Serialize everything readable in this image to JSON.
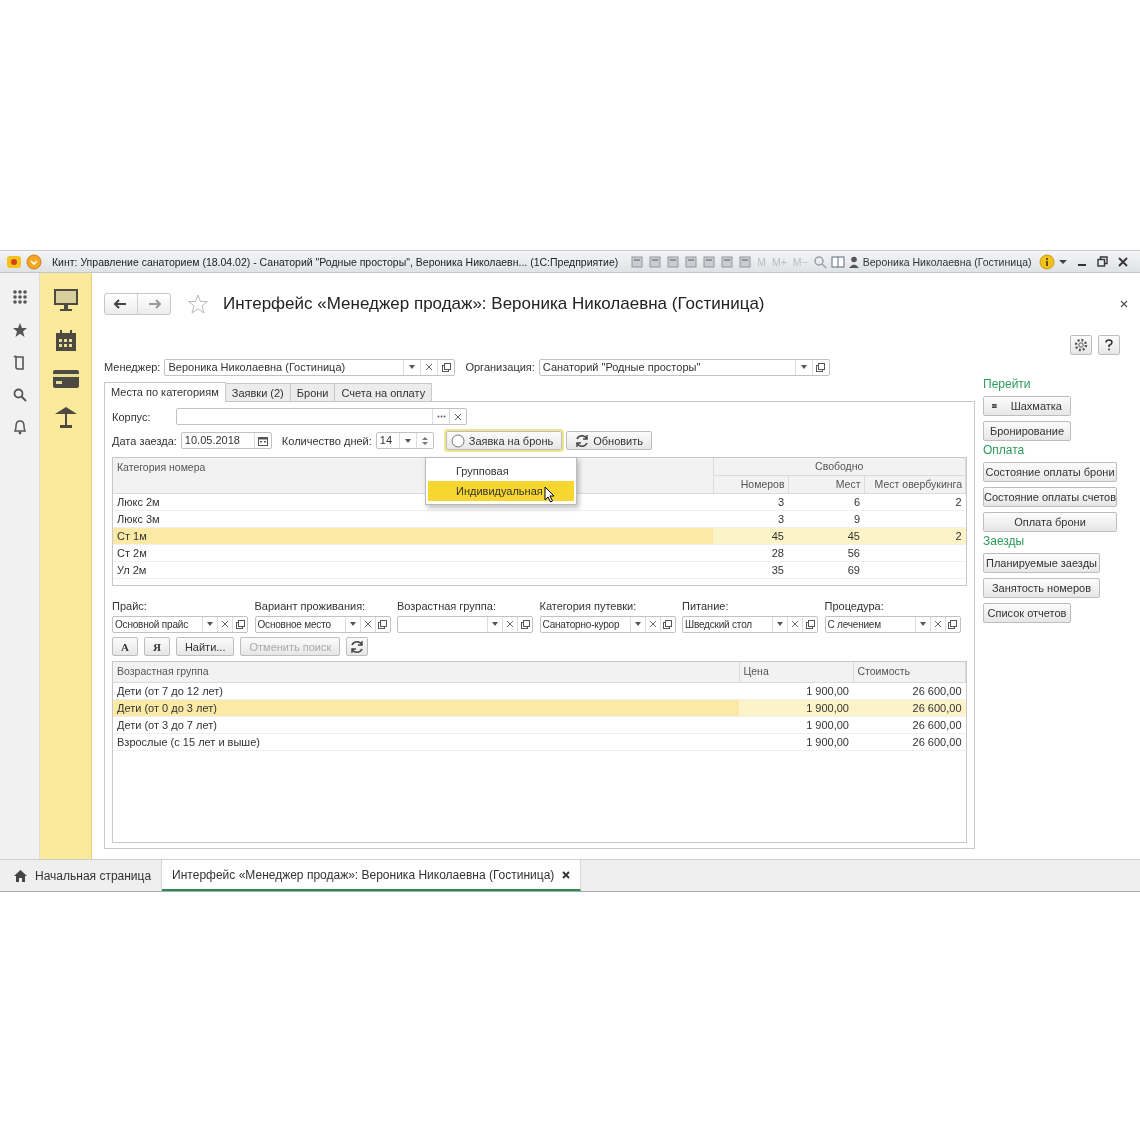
{
  "window": {
    "title": "Кинт: Управление санаторием (18.04.02) - Санаторий \"Родные просторы\", Вероника Николаевн...  (1С:Предприятие)",
    "memory_buttons": [
      "M",
      "M+",
      "M−"
    ],
    "user": "Вероника Николаевна (Гостиница)"
  },
  "form": {
    "title": "Интерфейс «Менеджер продаж»: Вероника Николаевна (Гостиница)",
    "manager": {
      "label": "Менеджер:",
      "value": "Вероника Николаевна (Гостиница)"
    },
    "organization": {
      "label": "Организация:",
      "value": "Санаторий \"Родные просторы\""
    },
    "tabs": [
      {
        "label": "Места по категориям",
        "selected": true
      },
      {
        "label": "Заявки (2)",
        "selected": false
      },
      {
        "label": "Брони",
        "selected": false
      },
      {
        "label": "Счета на оплату",
        "selected": false
      }
    ],
    "building": {
      "label": "Корпус:"
    },
    "arrival_date": {
      "label": "Дата заезда:",
      "value": "10.05.2018"
    },
    "days": {
      "label": "Количество дней:",
      "value": "14"
    },
    "request_button": "Заявка на бронь",
    "refresh_button": "Обновить",
    "request_menu": [
      {
        "label": "Групповая",
        "selected": false
      },
      {
        "label": "Индивидуальная",
        "selected": true
      }
    ],
    "rooms_table": {
      "category_header": "Категория номера",
      "group_header": "Свободно",
      "columns": [
        "Номеров",
        "Мест",
        "Мест овербукинга"
      ],
      "rows": [
        {
          "category": "Люкс 2м",
          "rooms": "3",
          "places": "6",
          "overbooking": "2",
          "selected": false
        },
        {
          "category": "Люкс 3м",
          "rooms": "3",
          "places": "9",
          "selected": false
        },
        {
          "category": "Ст 1м",
          "rooms": "45",
          "places": "45",
          "overbooking": "2",
          "selected": true
        },
        {
          "category": "Ст 2м",
          "rooms": "28",
          "places": "56",
          "selected": false
        },
        {
          "category": "Ул 2м",
          "rooms": "35",
          "places": "69",
          "selected": false
        }
      ]
    },
    "filters": [
      {
        "label": "Прайс:",
        "value": "Основной прайс"
      },
      {
        "label": "Вариант проживания:",
        "value": "Основное место"
      },
      {
        "label": "Возрастная группа:"
      },
      {
        "label": "Категория путевки:",
        "value": "Санаторно-курор"
      },
      {
        "label": "Питание:",
        "value": "Шведский стол"
      },
      {
        "label": "Процедура:",
        "value": "С лечением"
      }
    ],
    "search_buttons": [
      {
        "label": "А",
        "disabled": false,
        "kind": "letter"
      },
      {
        "label": "Я",
        "disabled": false,
        "kind": "letter"
      },
      {
        "label": "Найти...",
        "disabled": false,
        "kind": "text"
      },
      {
        "label": "Отменить поиск",
        "disabled": true,
        "kind": "text"
      }
    ],
    "prices_table": {
      "columns": [
        "Возрастная группа",
        "Цена",
        "Стоимость"
      ],
      "rows": [
        {
          "group": "Дети (от 7 до 12 лет)",
          "price": "1 900,00",
          "cost": "26 600,00",
          "selected": false
        },
        {
          "group": "Дети (от 0 до 3 лет)",
          "price": "1 900,00",
          "cost": "26 600,00",
          "selected": true
        },
        {
          "group": "Дети (от 3 до 7 лет)",
          "price": "1 900,00",
          "cost": "26 600,00",
          "selected": false
        },
        {
          "group": "Взрослые (с 15 лет и выше)",
          "price": "1 900,00",
          "cost": "26 600,00",
          "selected": false
        }
      ]
    }
  },
  "side_panel": [
    {
      "title": "Перейти",
      "buttons": [
        "Шахматка",
        "Бронирование"
      ]
    },
    {
      "title": "Оплата",
      "buttons": [
        "Состояние оплаты брони",
        "Состояние оплаты счетов",
        "Оплата брони"
      ]
    },
    {
      "title": "Заезды",
      "buttons": [
        "Планируемые заезды",
        "Занятость номеров",
        "Список отчетов"
      ]
    }
  ],
  "taskbar": [
    {
      "label": "Начальная страница",
      "selected": false,
      "kind": "home"
    },
    {
      "label": "Интерфейс «Менеджер продаж»: Вероника Николаевна (Гостиница)",
      "selected": true,
      "kind": "form"
    }
  ]
}
